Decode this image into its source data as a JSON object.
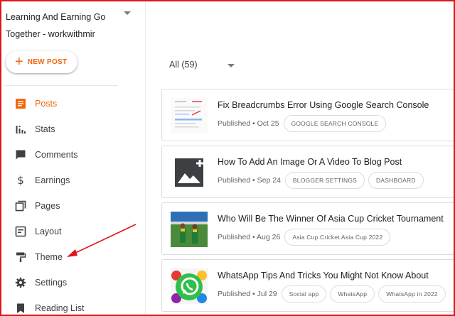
{
  "blog": {
    "title_line1": "Learning And Earning Go",
    "title_line2": "Together - workwithmir"
  },
  "new_post": {
    "label": "NEW POST",
    "icon": "plus-icon"
  },
  "nav": {
    "items": [
      {
        "label": "Posts",
        "icon": "posts-icon",
        "active": true
      },
      {
        "label": "Stats",
        "icon": "stats-icon"
      },
      {
        "label": "Comments",
        "icon": "comments-icon"
      },
      {
        "label": "Earnings",
        "icon": "dollar-icon"
      },
      {
        "label": "Pages",
        "icon": "pages-icon"
      },
      {
        "label": "Layout",
        "icon": "layout-icon"
      },
      {
        "label": "Theme",
        "icon": "paint-roller-icon"
      },
      {
        "label": "Settings",
        "icon": "gear-icon"
      },
      {
        "label": "Reading List",
        "icon": "bookmark-icon"
      }
    ]
  },
  "filter": {
    "label": "All (59)"
  },
  "posts": [
    {
      "title": "Fix Breadcrumbs Error Using Google Search Console",
      "date": "Published • Oct 25",
      "chips": [
        "GOOGLE SEARCH CONSOLE"
      ]
    },
    {
      "title": "How To Add An Image Or A Video To Blog Post",
      "date": "Published • Sep 24",
      "chips": [
        "BLOGGER SETTINGS",
        "DASHBOARD"
      ]
    },
    {
      "title": "Who Will Be The Winner Of Asia Cup Cricket Tournament",
      "date": "Published • Aug 26",
      "chips": [
        "Asia Cup Cricket Asia Cup 2022"
      ]
    },
    {
      "title": "WhatsApp Tips And Tricks You Might Not Know About",
      "date": "Published • Jul 29",
      "chips": [
        "Social app",
        "WhatsApp",
        "WhatsApp in 2022"
      ]
    }
  ],
  "colors": {
    "accent": "#f4660a",
    "frame": "#e0141b",
    "annotation": "#e0141b"
  }
}
